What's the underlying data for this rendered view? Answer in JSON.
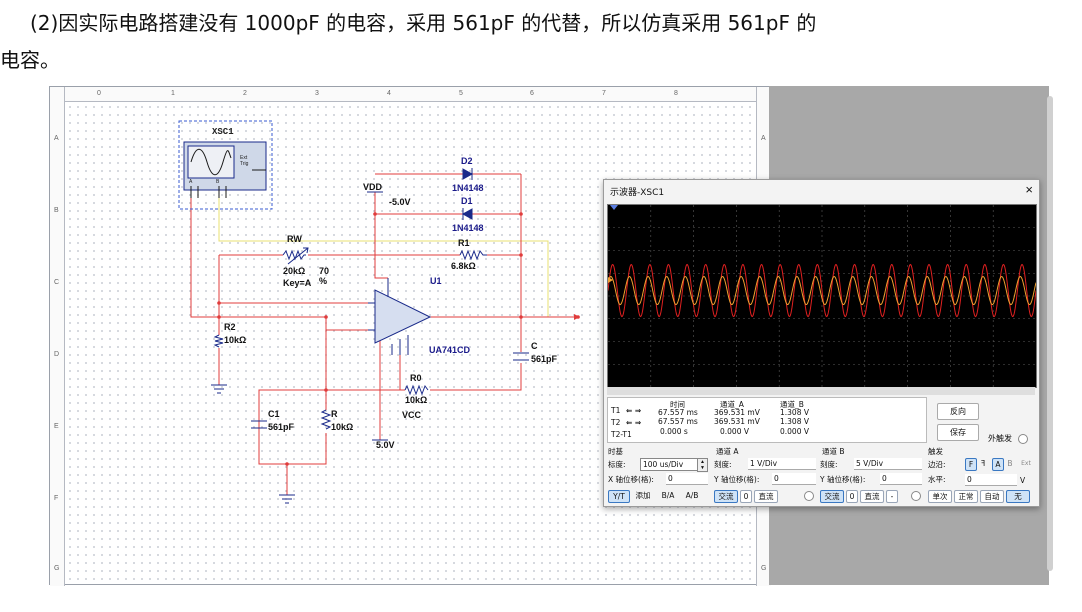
{
  "document": {
    "line1": "(2)因实际电路搭建没有 1000pF 的电容，采用 561pF 的代替，所以仿真采用 561pF 的",
    "line2": "电容。"
  },
  "ruler": {
    "columns": [
      "0",
      "1",
      "2",
      "3",
      "4",
      "5",
      "6",
      "7",
      "8"
    ],
    "rows": [
      "A",
      "B",
      "C",
      "D",
      "E",
      "F",
      "G"
    ]
  },
  "schematic": {
    "xsc1": "XSC1",
    "ext_trig": "Ext Trig",
    "ch_a": "A",
    "ch_b": "B",
    "vdd": "VDD",
    "vdd_value": "-5.0V",
    "d2": "D2",
    "d2_model": "1N4148",
    "d1": "D1",
    "d1_model": "1N4148",
    "rw": "RW",
    "rw_value": "20kΩ",
    "rw_percent": "70 %",
    "rw_key": "Key=A",
    "r1": "R1",
    "r1_value": "6.8kΩ",
    "u1": "U1",
    "u1_model": "UA741CD",
    "r2": "R2",
    "r2_value": "10kΩ",
    "c": "C",
    "c_value": "561pF",
    "r0": "R0",
    "r0_value": "10kΩ",
    "vcc": "VCC",
    "vcc_value": "5.0V",
    "c1": "C1",
    "c1_value": "561pF",
    "r": "R",
    "r_value": "10kΩ",
    "colors": {
      "wire_red": "#e03c3c",
      "wire_yellow": "#e8e070",
      "part": "#1a2a8a",
      "label": "#1a1a8a"
    }
  },
  "scope": {
    "title": "示波器-XSC1",
    "close": "×",
    "traces": {
      "a_color": "#f0a030",
      "b_color": "#e02020",
      "cycles": 23
    },
    "table": {
      "col_time": "时间",
      "col_a": "通道_A",
      "col_b": "通道_B",
      "t1": "T1",
      "t2": "T2",
      "t2t1": "T2-T1",
      "t1_time": "67.557 ms",
      "t1_a": "369.531 mV",
      "t1_b": "1.308 V",
      "t2_time": "67.557 ms",
      "t2_a": "369.531 mV",
      "t2_b": "1.308 V",
      "d_time": "0.000 s",
      "d_a": "0.000 V",
      "d_b": "0.000 V",
      "arrows": "⇐ ⇒"
    },
    "btn_reverse": "反向",
    "btn_save": "保存",
    "ext_trigger": "外触发",
    "timebase": {
      "title": "时基",
      "scale_label": "标度:",
      "scale": "100 us/Div",
      "xpos_label": "X 轴位移(格):",
      "xpos": "0",
      "btns": [
        "Y/T",
        "添加",
        "B/A",
        "A/B"
      ]
    },
    "channel_a": {
      "title": "通道 A",
      "scale_label": "刻度:",
      "scale": "1  V/Div",
      "ypos_label": "Y 轴位移(格):",
      "ypos": "0",
      "btns": [
        "交流",
        "0",
        "直流"
      ]
    },
    "channel_b": {
      "title": "通道 B",
      "scale_label": "刻度:",
      "scale": "5  V/Div",
      "ypos_label": "Y 轴位移(格):",
      "ypos": "0",
      "btns": [
        "交流",
        "0",
        "直流",
        "-"
      ]
    },
    "trigger": {
      "title": "触发",
      "edge_label": "边沿:",
      "edge_btns": [
        "F",
        "ꟻ",
        "A",
        "B",
        "Ext"
      ],
      "level_label": "水平:",
      "level": "0",
      "level_unit": "V",
      "mode_btns": [
        "单次",
        "正常",
        "自动",
        "无"
      ]
    }
  }
}
